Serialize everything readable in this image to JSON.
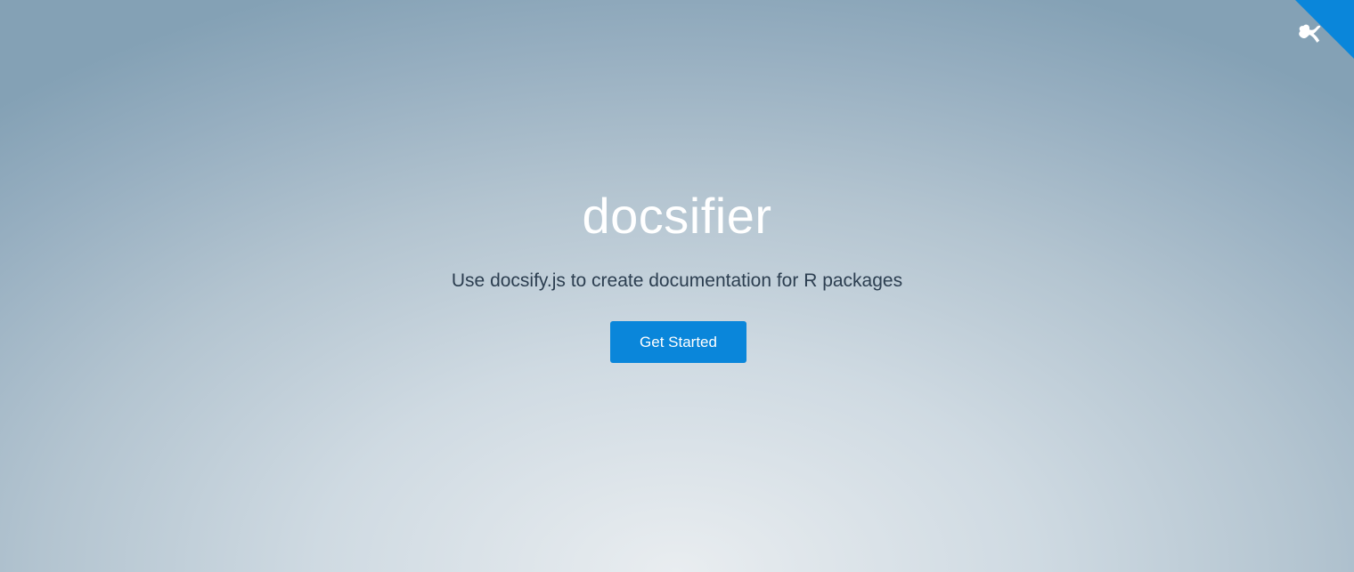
{
  "cover": {
    "title": "docsifier",
    "tagline": "Use docsify.js to create documentation for R packages",
    "button_label": "Get Started"
  },
  "corner": {
    "icon": "github-octocat-icon"
  },
  "colors": {
    "accent": "#0a86da",
    "title_text": "#ffffff",
    "tagline_text": "#2c3e50",
    "background_center": "#e9edf0",
    "background_edge": "#84a1b5"
  }
}
